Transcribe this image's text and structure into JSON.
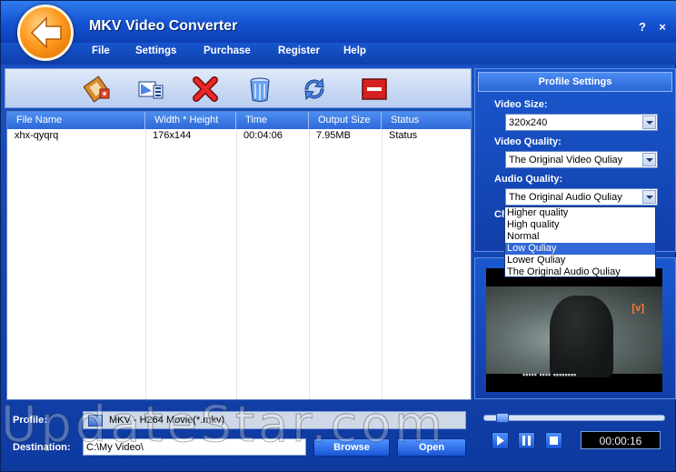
{
  "window": {
    "title": "MKV Video Converter",
    "help": "?",
    "close": "×"
  },
  "menu": {
    "items": [
      "File",
      "Settings",
      "Purchase",
      "Register",
      "Help"
    ]
  },
  "toolbar": {
    "icons": [
      "add-file-icon",
      "settings-icon",
      "delete-icon",
      "clear-icon",
      "convert-icon",
      "stop-icon"
    ]
  },
  "file_list": {
    "columns": [
      "File Name",
      "Width * Height",
      "Time",
      "Output Size",
      "Status"
    ],
    "rows": [
      [
        "xhx-qyqrq",
        "176x144",
        "00:04:06",
        "7.95MB",
        "Status"
      ]
    ]
  },
  "profile": {
    "label": "Profile:",
    "value": "MKV - H264 Movie(*.mkv)"
  },
  "destination": {
    "label": "Destination:",
    "value": "C:\\My Video\\"
  },
  "buttons": {
    "browse": "Browse",
    "open": "Open"
  },
  "profile_settings": {
    "title": "Profile Settings",
    "video_size_label": "Video Size:",
    "video_size": "320x240",
    "video_quality_label": "Video Quality:",
    "video_quality": "The Original Video Quliay",
    "audio_quality_label": "Audio Quality:",
    "audio_quality": "The Original Audio Quliay",
    "hidden_label_fragment": "Ch",
    "audio_options": [
      "Higher quality",
      "High quality",
      "Normal",
      "Low Quliay",
      "Lower Quliay",
      "The Original Audio Quliay"
    ],
    "highlighted_option": "Low Quliay"
  },
  "preview": {
    "channel_logo": "[v]",
    "subtitle": "▪▪▪▪▪ ▪▪▪▪ ▪▪▪▪▪▪▪▪"
  },
  "player": {
    "time": "00:00:16",
    "seek_fraction": 0.07
  },
  "watermark": "UpdateStar.com"
}
